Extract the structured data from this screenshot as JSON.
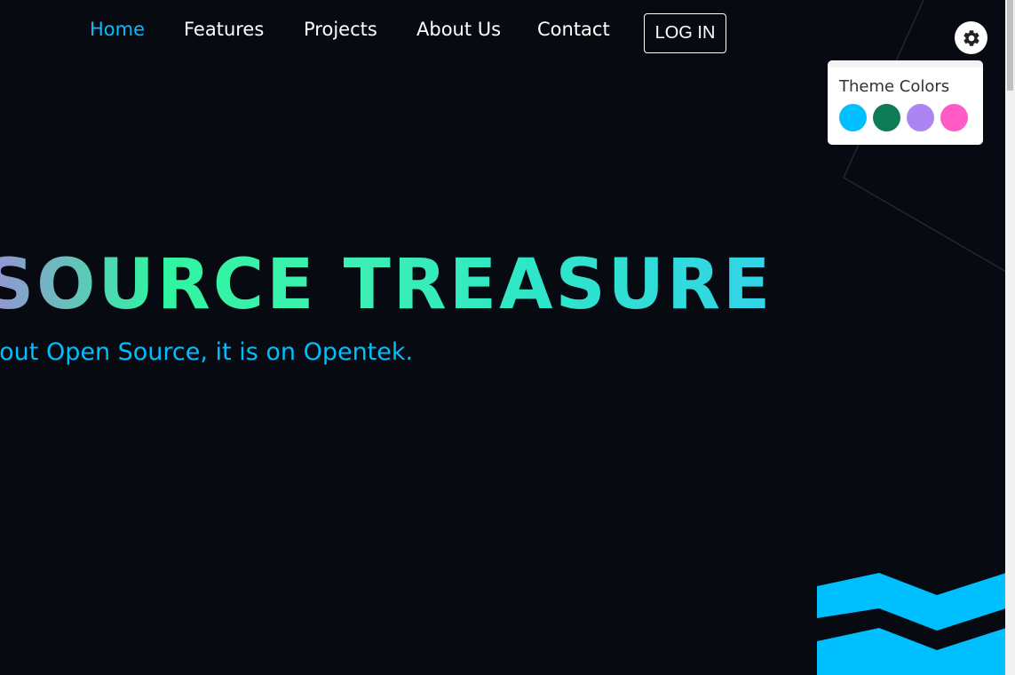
{
  "nav": {
    "items": [
      {
        "label": "Home",
        "active": true
      },
      {
        "label": "Features",
        "active": false
      },
      {
        "label": "Projects",
        "active": false
      },
      {
        "label": "About Us",
        "active": false
      },
      {
        "label": "Contact",
        "active": false
      }
    ],
    "login_label": "LOG IN"
  },
  "settings": {
    "icon": "gear-icon",
    "panel_title": "Theme Colors",
    "swatches": [
      "#00bfff",
      "#0e7b57",
      "#ad84f4",
      "#ff5ac6"
    ]
  },
  "hero": {
    "title": "SOURCE TREASURE",
    "subtitle": "bout Open Source, it is on Opentek."
  },
  "colors": {
    "background": "#070a10",
    "accent": "#00bfff",
    "gradient_start": "#9b8fd6",
    "gradient_mid": "#2ff5a0",
    "gradient_end": "#33d3e9"
  }
}
